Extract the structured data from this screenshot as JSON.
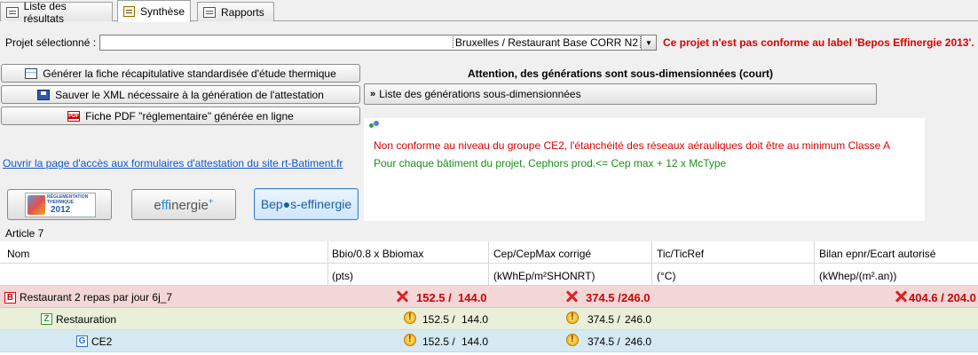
{
  "tabs": [
    {
      "label": "Liste des résultats",
      "icon": "list-icon"
    },
    {
      "label": "Synthèse",
      "icon": "synthesis-icon"
    },
    {
      "label": "Rapports",
      "icon": "report-icon"
    }
  ],
  "project": {
    "label": "Projet sélectionné :",
    "value": "Bruxelles  /  Restaurant Base CORR N2",
    "warning": "Ce projet n'est pas conforme au label 'Bepos Effinergie 2013'."
  },
  "actions": {
    "generate_sheet": "Générer la fiche récapitulative standardisée d'étude thermique",
    "save_xml": "Sauver le XML nécessaire à la génération de l'attestation",
    "pdf": "Fiche PDF \"réglementaire\" générée en ligne"
  },
  "generations": {
    "title": "Attention, des générations sont sous-dimensionnées (court)",
    "button": "Liste des générations sous-dimensionnées",
    "chevron": "»"
  },
  "messages": [
    "Non conforme au niveau du groupe CE2, l'étanchéité des réseaux aérauliques doit être au minimum Classe A",
    "Pour chaque bâtiment du projet, Cephors prod.<= Cep max + 12 x McType"
  ],
  "link": "Ouvrir la page d'accès aux formulaires d'attestation du site rt-Batiment.fr",
  "logos": {
    "rt2012_line1": "RÉGLEMENTATION",
    "rt2012_line2": "THERMIQUE",
    "rt2012_year": "2012",
    "effinergie_prefix": "e",
    "effinergie_highlight": "ff",
    "effinergie_rest": "inergie",
    "effinergie_plus": "+",
    "bepos": "Bep●s-effinergie"
  },
  "table": {
    "section": "Article 7",
    "columns": [
      "Nom",
      "Bbio/0.8 x Bbiomax",
      "Cep/CepMax corrigé",
      "Tic/TicRef",
      "Bilan epnr/Ecart autorisé"
    ],
    "units": [
      "",
      "(pts)",
      "(kWhEp/m²SHONRT)",
      "(°C)",
      "(kWhep/(m².an))"
    ],
    "rows": [
      {
        "type": "B",
        "name": "Restaurant 2 repas par jour 6j_7",
        "bbio": "152.5 /",
        "bbio_max": "144.0",
        "cep": "374.5 /",
        "cep_max": "246.0",
        "bilan": "404.6 / 204.0",
        "status": "fail"
      },
      {
        "type": "Z",
        "name": "Restauration",
        "bbio": "152.5 /",
        "bbio_max": "144.0",
        "cep": "374.5 /",
        "cep_max": "246.0",
        "status": "warn"
      },
      {
        "type": "G",
        "name": "CE2",
        "bbio": "152.5 /",
        "bbio_max": "144.0",
        "cep": "374.5 /",
        "cep_max": "246.0",
        "status": "warn"
      }
    ]
  }
}
